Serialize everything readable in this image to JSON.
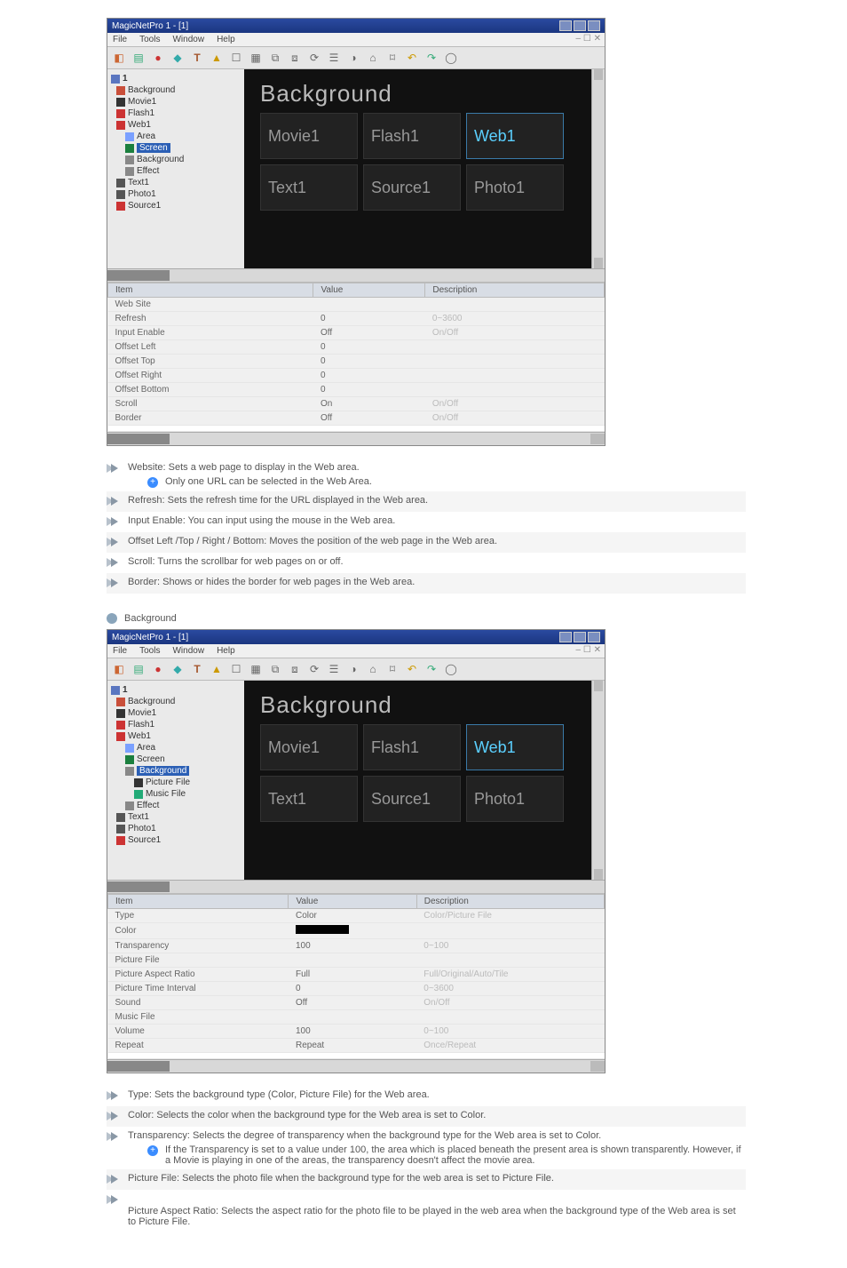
{
  "app": {
    "title": "MagicNetPro 1 - [1]",
    "menus": [
      "File",
      "Tools",
      "Window",
      "Help"
    ]
  },
  "canvas": {
    "heading": "Background",
    "cells": [
      "Movie1",
      "Flash1",
      "Web1",
      "Text1",
      "Source1",
      "Photo1"
    ],
    "activeIndexA": 2,
    "tree1": {
      "root": "1",
      "nodes": [
        {
          "label": "Background",
          "lvl": 1,
          "icon": "#c94f3a"
        },
        {
          "label": "Movie1",
          "lvl": 1,
          "icon": "#333"
        },
        {
          "label": "Flash1",
          "lvl": 1,
          "icon": "#c33"
        },
        {
          "label": "Web1",
          "lvl": 1,
          "icon": "#c33"
        },
        {
          "label": "Area",
          "lvl": 2,
          "icon": "#7aa0ff"
        },
        {
          "label": "Screen",
          "lvl": 2,
          "icon": "#1b7f3e",
          "sel": true
        },
        {
          "label": "Background",
          "lvl": 2,
          "icon": "#888"
        },
        {
          "label": "Effect",
          "lvl": 2,
          "icon": "#888"
        },
        {
          "label": "Text1",
          "lvl": 1,
          "icon": "#555"
        },
        {
          "label": "Photo1",
          "lvl": 1,
          "icon": "#555"
        },
        {
          "label": "Source1",
          "lvl": 1,
          "icon": "#c33"
        }
      ]
    },
    "tree2": {
      "root": "1",
      "nodes": [
        {
          "label": "Background",
          "lvl": 1,
          "icon": "#c94f3a"
        },
        {
          "label": "Movie1",
          "lvl": 1,
          "icon": "#333"
        },
        {
          "label": "Flash1",
          "lvl": 1,
          "icon": "#c33"
        },
        {
          "label": "Web1",
          "lvl": 1,
          "icon": "#c33"
        },
        {
          "label": "Area",
          "lvl": 2,
          "icon": "#7aa0ff"
        },
        {
          "label": "Screen",
          "lvl": 2,
          "icon": "#1b7f3e"
        },
        {
          "label": "Background",
          "lvl": 2,
          "icon": "#888",
          "sel": true
        },
        {
          "label": "Picture File",
          "lvl": 3,
          "icon": "#333"
        },
        {
          "label": "Music File",
          "lvl": 3,
          "icon": "#2a7"
        },
        {
          "label": "Effect",
          "lvl": 2,
          "icon": "#888"
        },
        {
          "label": "Text1",
          "lvl": 1,
          "icon": "#555"
        },
        {
          "label": "Photo1",
          "lvl": 1,
          "icon": "#555"
        },
        {
          "label": "Source1",
          "lvl": 1,
          "icon": "#c33"
        }
      ]
    }
  },
  "props1": {
    "headers": [
      "Item",
      "Value",
      "Description"
    ],
    "rows": [
      {
        "n": "Web Site",
        "v": "",
        "d": ""
      },
      {
        "n": "Refresh",
        "v": "0",
        "d": "0~3600"
      },
      {
        "n": "Input Enable",
        "v": "Off",
        "d": "On/Off"
      },
      {
        "n": "Offset Left",
        "v": "0",
        "d": ""
      },
      {
        "n": "Offset Top",
        "v": "0",
        "d": ""
      },
      {
        "n": "Offset Right",
        "v": "0",
        "d": ""
      },
      {
        "n": "Offset Bottom",
        "v": "0",
        "d": ""
      },
      {
        "n": "Scroll",
        "v": "On",
        "d": "On/Off"
      },
      {
        "n": "Border",
        "v": "Off",
        "d": "On/Off"
      }
    ]
  },
  "props2": {
    "headers": [
      "Item",
      "Value",
      "Description"
    ],
    "rows": [
      {
        "n": "Type",
        "v": "Color",
        "d": "Color/Picture File"
      },
      {
        "n": "Color",
        "v": "[box]",
        "d": ""
      },
      {
        "n": "Transparency",
        "v": "100",
        "d": "0~100"
      },
      {
        "n": "Picture File",
        "v": "",
        "d": ""
      },
      {
        "n": "Picture Aspect Ratio",
        "v": "Full",
        "d": "Full/Original/Auto/Tile"
      },
      {
        "n": "Picture Time Interval",
        "v": "0",
        "d": "0~3600"
      },
      {
        "n": "Sound",
        "v": "Off",
        "d": "On/Off"
      },
      {
        "n": "Music File",
        "v": "",
        "d": ""
      },
      {
        "n": "Volume",
        "v": "100",
        "d": "0~100"
      },
      {
        "n": "Repeat",
        "v": "Repeat",
        "d": "Once/Repeat"
      }
    ]
  },
  "desc1": [
    {
      "t": "Website: Sets a web page to display in the Web area.",
      "sub": "Only one URL can be selected in the Web Area."
    },
    {
      "t": "Refresh: Sets the refresh time for the URL displayed in the Web area."
    },
    {
      "t": "Input Enable: You can input using the mouse in the Web area."
    },
    {
      "t": "Offset Left /Top / Right / Bottom: Moves the position of the web page in the Web area."
    },
    {
      "t": "Scroll: Turns the scrollbar for web pages on or off."
    },
    {
      "t": "Border: Shows or hides the border for web pages in the Web area."
    }
  ],
  "section2": "Background",
  "desc2": [
    {
      "t": "Type: Sets the background type (Color, Picture File) for the Web area."
    },
    {
      "t": "Color: Selects the color when the background type for the Web area is set to Color."
    },
    {
      "t": "Transparency: Selects the degree of transparency when the background type for the Web area is set to Color.",
      "sub": "If the Transparency is set to a value under 100, the area which is placed beneath the present area is shown transparently. However, if a Movie is playing in one of the areas, the transparency doesn't affect the movie area."
    },
    {
      "t": "Picture File: Selects the photo file when the background type for the web area is set to Picture File."
    },
    {
      "t": "",
      "extra": "Picture Aspect Ratio: Selects the aspect ratio for the photo file to be played in the web area when the background type of the Web area is set to Picture File."
    }
  ]
}
